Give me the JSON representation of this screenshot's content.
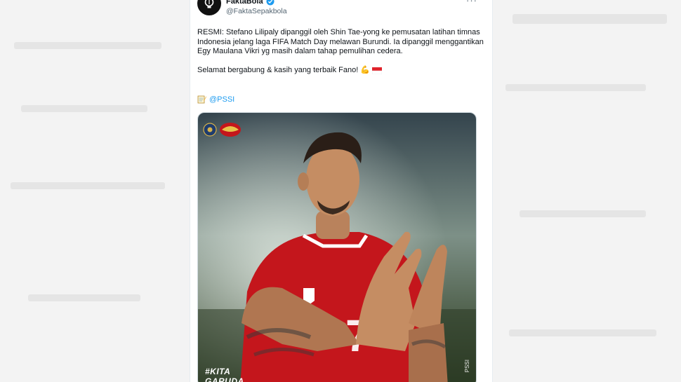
{
  "account": {
    "display_name": "FaktaBola",
    "handle": "@FaktaSepakbola",
    "verified": true
  },
  "toolbar": {
    "more_label": "···"
  },
  "tweet": {
    "text_p1": "RESMI: Stefano Lilipaly dipanggil oleh Shin Tae-yong ke pemusatan latihan timnas Indonesia jelang laga FIFA Match Day melawan Burundi. Ia dipanggil menggantikan Egy Maulana Vikri yg masih dalam tahap pemulihan cedera.",
    "text_p2": "Selamat bergabung & kasih yang terbaik Fano!",
    "emoji_flex": "💪",
    "emoji_flag": "flag-indonesia",
    "mention": "@PSSI",
    "mention_icon": "memo-icon"
  },
  "media": {
    "overlay_text_line1": "#KITA",
    "overlay_text_line2": "GARUDA",
    "watermark": "PSSI",
    "jersey_number": "7",
    "colors": {
      "jersey": "#c4161c",
      "background_top": "#3a4750",
      "accent": "#1d9bf0"
    }
  }
}
